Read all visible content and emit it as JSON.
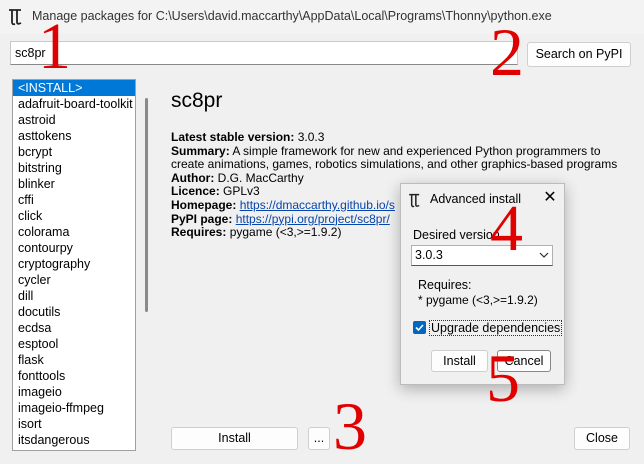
{
  "window": {
    "title": "Manage packages for C:\\Users\\david.maccarthy\\AppData\\Local\\Programs\\Thonny\\python.exe",
    "icon": "thonny-app-icon"
  },
  "search": {
    "value": "sc8pr",
    "button_label": "Search on PyPI"
  },
  "package_list": {
    "selected_index": 0,
    "items": [
      "<INSTALL>",
      "adafruit-board-toolkit",
      "astroid",
      "asttokens",
      "bcrypt",
      "bitstring",
      "blinker",
      "cffi",
      "click",
      "colorama",
      "contourpy",
      "cryptography",
      "cycler",
      "dill",
      "docutils",
      "ecdsa",
      "esptool",
      "flask",
      "fonttools",
      "imageio",
      "imageio-ffmpeg",
      "isort",
      "itsdangerous"
    ]
  },
  "details": {
    "name": "sc8pr",
    "latest_label": "Latest stable version:",
    "latest_value": "3.0.3",
    "summary_label": "Summary:",
    "summary_line1": "A simple framework for new and experienced Python programmers to",
    "summary_line2": "create animations, games, robotics simulations, and other graphics-based programs",
    "author_label": "Author:",
    "author_value": "D.G. MacCarthy",
    "licence_label": "Licence:",
    "licence_value": "GPLv3",
    "homepage_label": "Homepage:",
    "homepage_value": "https://dmaccarthy.github.io/s",
    "pypi_label": "PyPI page:",
    "pypi_value": "https://pypi.org/project/sc8pr/",
    "requires_label": "Requires:",
    "requires_value": "pygame (<3,>=1.9.2)"
  },
  "buttons": {
    "install": "Install",
    "more": "...",
    "close": "Close"
  },
  "dialog": {
    "title": "Advanced install",
    "close_glyph": "✕",
    "version_label": "Desired version",
    "version_value": "3.0.3",
    "requires_label": "Requires:",
    "requires_value": "* pygame (<3,>=1.9.2)",
    "upgrade_label": "Upgrade dependencies",
    "upgrade_checked": true,
    "install_label": "Install",
    "cancel_label": "Cancel"
  },
  "annotations": [
    "1",
    "2",
    "3",
    "4",
    "5"
  ],
  "colors": {
    "selection": "#0078d7",
    "link": "#0645ad",
    "annotation": "#e00000",
    "checkbox": "#0067c0"
  }
}
